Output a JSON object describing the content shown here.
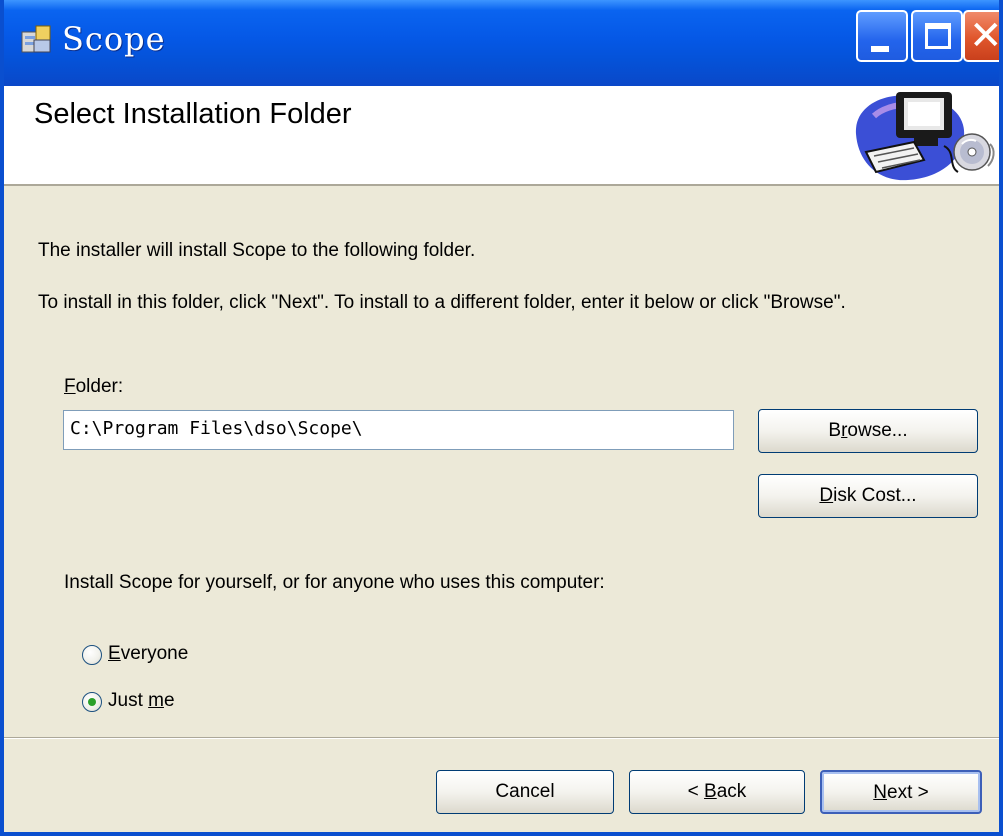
{
  "window": {
    "title": "Scope",
    "colors": {
      "titlebar": "#0558e6",
      "close": "#e0562c",
      "face": "#ece9d8"
    }
  },
  "banner": {
    "title": "Select Installation Folder"
  },
  "content": {
    "intro": "The installer will install Scope to the following folder.",
    "instructions": "To install in this folder, click \"Next\". To install to a different folder, enter it below or click \"Browse\".",
    "folder_label_hotkey": "F",
    "folder_label_rest": "older:",
    "folder_value": "C:\\Program Files\\dso\\Scope\\",
    "browse_hotkey": "r",
    "browse_pre": "B",
    "browse_post": "owse...",
    "disk_hotkey": "D",
    "disk_post": "isk Cost...",
    "install_for": "Install Scope for yourself, or for anyone who uses this computer:",
    "radio_everyone_hotkey": "E",
    "radio_everyone_post": "veryone",
    "radio_justme_pre": "Just ",
    "radio_justme_hotkey": "m",
    "radio_justme_post": "e",
    "selected_option": "Just me"
  },
  "footer": {
    "cancel_label": "Cancel",
    "back_pre": "< ",
    "back_hotkey": "B",
    "back_post": "ack",
    "next_hotkey": "N",
    "next_post": "ext >"
  }
}
